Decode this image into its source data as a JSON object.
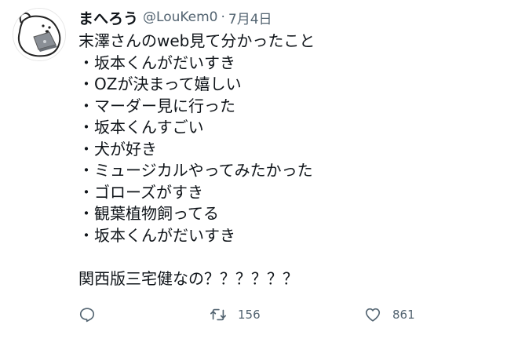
{
  "tweet": {
    "display_name": "まへろう",
    "handle": "@LouKem0",
    "separator": "·",
    "date": "7月4日",
    "lines": [
      "末澤さんのweb見て分かったこと",
      "・坂本くんがだいすき",
      "・OZが決まって嬉しい",
      "・マーダー見に行った",
      "・坂本くんすごい",
      "・犬が好き",
      "・ミュージカルやってみたかった",
      "・ゴローズがすき",
      "・観葉植物飼ってる",
      "・坂本くんがだいすき"
    ],
    "closing_line": "関西版三宅健なの？？？？？？"
  },
  "actions": {
    "reply_icon": "reply-icon",
    "retweet_icon": "retweet-icon",
    "retweet_count": "156",
    "like_icon": "heart-icon",
    "like_count": "861"
  },
  "colors": {
    "text": "#0f1419",
    "secondary": "#536471",
    "background": "#ffffff"
  }
}
